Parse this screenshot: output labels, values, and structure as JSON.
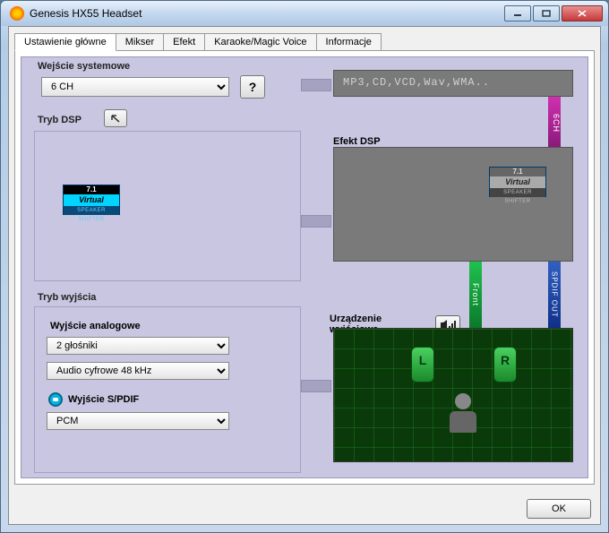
{
  "window": {
    "title": "Genesis HX55 Headset"
  },
  "tabs": [
    "Ustawienie główne",
    "Mikser",
    "Efekt",
    "Karaoke/Magic Voice",
    "Informacje"
  ],
  "active_tab": 0,
  "system_input": {
    "label": "Wejście systemowe",
    "value": "6 CH",
    "help": "?"
  },
  "dsp_mode": {
    "label": "Tryb DSP",
    "badge": {
      "top": "7.1",
      "mid": "Virtual",
      "bot": "SPEAKER SHIFTER"
    }
  },
  "output_mode": {
    "label": "Tryb wyjścia",
    "analog_label": "Wyjście analogowe",
    "analog_value": "2 głośniki",
    "digital_value": "Audio cyfrowe 48 kHz",
    "spdif_label": "Wyjście S/PDIF",
    "spdif_value": "PCM"
  },
  "formats_display": "MP3,CD,VCD,Wav,WMA..",
  "bands": {
    "sixch": "6CH",
    "front": "Front",
    "spdif": "SPDIF OUT"
  },
  "dsp_effect": {
    "label": "Efekt DSP",
    "badge": {
      "top": "7.1",
      "mid": "Virtual",
      "bot": "SPEAKER SHIFTER"
    }
  },
  "output_device": {
    "label": "Urządzenie wyjściowe",
    "left": "L",
    "right": "R"
  },
  "footer": {
    "ok": "OK"
  }
}
